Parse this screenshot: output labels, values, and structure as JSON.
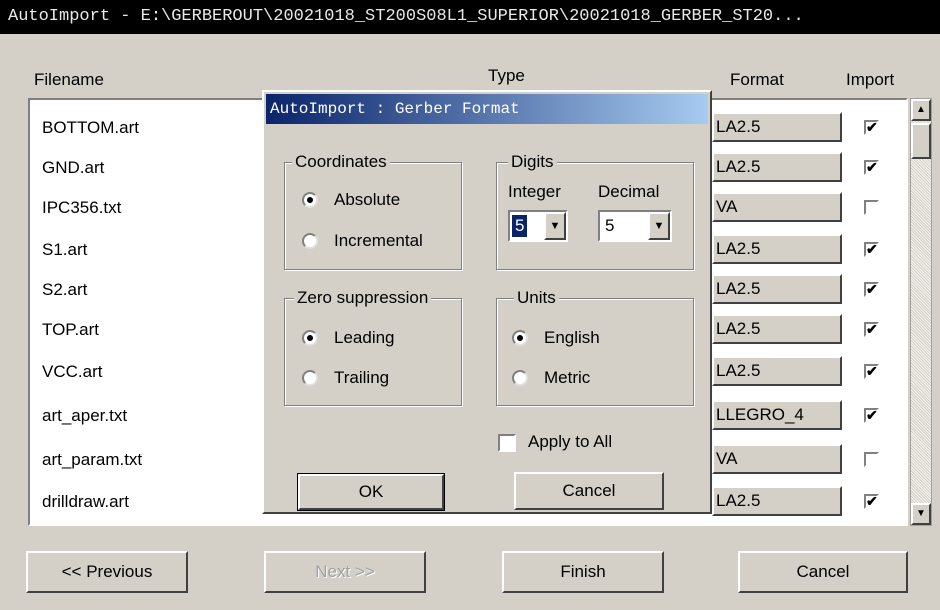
{
  "window": {
    "title": "AutoImport - E:\\GERBEROUT\\20021018_ST200S08L1_SUPERIOR\\20021018_GERBER_ST20..."
  },
  "list": {
    "headers": {
      "filename": "Filename",
      "type": "Type",
      "format": "Format",
      "import": "Import"
    },
    "rows": [
      {
        "filename": "BOTTOM.art",
        "format": "LA2.5",
        "checked": true,
        "mark": "✔"
      },
      {
        "filename": "GND.art",
        "format": "LA2.5",
        "checked": true,
        "mark": "✔"
      },
      {
        "filename": "IPC356.txt",
        "format": "VA",
        "checked": false,
        "mark": ""
      },
      {
        "filename": "S1.art",
        "format": "LA2.5",
        "checked": true,
        "mark": "✔"
      },
      {
        "filename": "S2.art",
        "format": "LA2.5",
        "checked": true,
        "mark": "✔"
      },
      {
        "filename": "TOP.art",
        "format": "LA2.5",
        "checked": true,
        "mark": "✔"
      },
      {
        "filename": "VCC.art",
        "format": "LA2.5",
        "checked": true,
        "mark": "✔"
      },
      {
        "filename": "art_aper.txt",
        "format": "LLEGRO_4",
        "checked": true,
        "mark": "✔"
      },
      {
        "filename": "art_param.txt",
        "format": "VA",
        "checked": false,
        "mark": ""
      },
      {
        "filename": "drilldraw.art",
        "format": "LA2.5",
        "checked": true,
        "mark": "✔"
      }
    ]
  },
  "buttons": {
    "previous": "<< Previous",
    "next": "Next >>",
    "finish": "Finish",
    "cancel": "Cancel"
  },
  "dialog": {
    "title": "AutoImport : Gerber Format",
    "coordinates": {
      "label": "Coordinates",
      "absolute": "Absolute",
      "incremental": "Incremental",
      "selected": "Absolute"
    },
    "digits": {
      "label": "Digits",
      "integer_label": "Integer",
      "decimal_label": "Decimal",
      "integer_value": "5",
      "decimal_value": "5"
    },
    "zero_suppression": {
      "label": "Zero suppression",
      "leading": "Leading",
      "trailing": "Trailing",
      "selected": "Leading"
    },
    "units": {
      "label": "Units",
      "english": "English",
      "metric": "Metric",
      "selected": "English"
    },
    "apply_to_all": {
      "label": "Apply to All",
      "checked": false
    },
    "ok": "OK",
    "cancel": "Cancel"
  },
  "icons": {
    "check": "check-icon",
    "dropdown": "chevron-down-icon",
    "scroll_up": "scroll-up-icon",
    "scroll_down": "scroll-down-icon"
  }
}
